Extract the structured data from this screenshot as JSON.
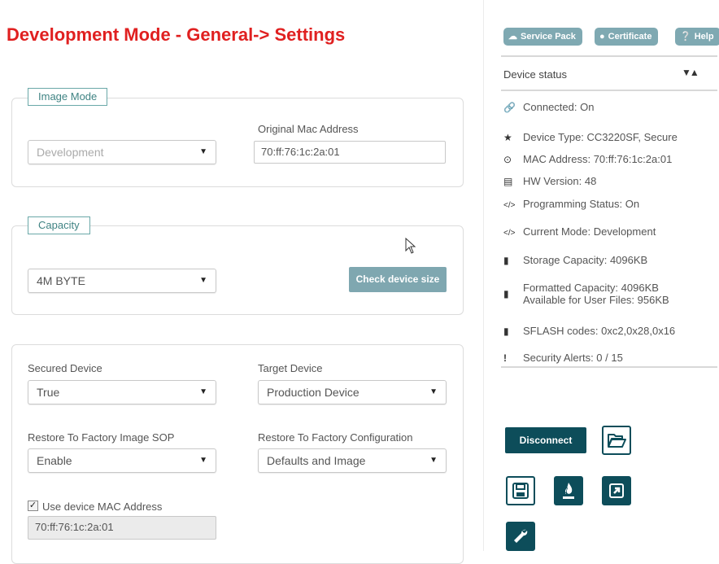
{
  "title": "Development Mode - General-> Settings",
  "image_mode": {
    "legend": "Image Mode",
    "mode_value": "Development",
    "mac_label": "Original Mac Address",
    "mac_value": "70:ff:76:1c:2a:01"
  },
  "capacity": {
    "legend": "Capacity",
    "value": "4M BYTE",
    "check_button": "Check device size"
  },
  "settings": {
    "secured_label": "Secured Device",
    "secured_value": "True",
    "target_label": "Target Device",
    "target_value": "Production Device",
    "restore_image_label": "Restore To Factory Image SOP",
    "restore_image_value": "Enable",
    "restore_config_label": "Restore To Factory Configuration",
    "restore_config_value": "Defaults and Image",
    "use_mac_label": "Use device MAC Address",
    "use_mac_checked": true,
    "use_mac_value": "70:ff:76:1c:2a:01"
  },
  "top_buttons": {
    "service_pack": "Service Pack",
    "certificate": "Certificate",
    "help": "Help"
  },
  "device_status": {
    "heading": "Device status",
    "connected": "Connected: On",
    "device_type": "Device Type: CC3220SF, Secure",
    "mac": "MAC Address: 70:ff:76:1c:2a:01",
    "hw_version": "HW Version: 48",
    "programming_status": "Programming Status: On",
    "current_mode": "Current Mode: Development",
    "storage_capacity": "Storage Capacity: 4096KB",
    "formatted_capacity": "Formatted Capacity: 4096KB",
    "available_user_files": "Available for User Files: 956KB",
    "sflash_codes": "SFLASH codes: 0xc2,0x28,0x16",
    "security_alerts": "Security Alerts: 0 / 15"
  },
  "actions": {
    "disconnect": "Disconnect"
  },
  "colors": {
    "title": "#e02020",
    "accent_teal": "#0d4d5a",
    "pill_bg": "#7fa9b2",
    "legend_border": "#6aa8a8"
  }
}
